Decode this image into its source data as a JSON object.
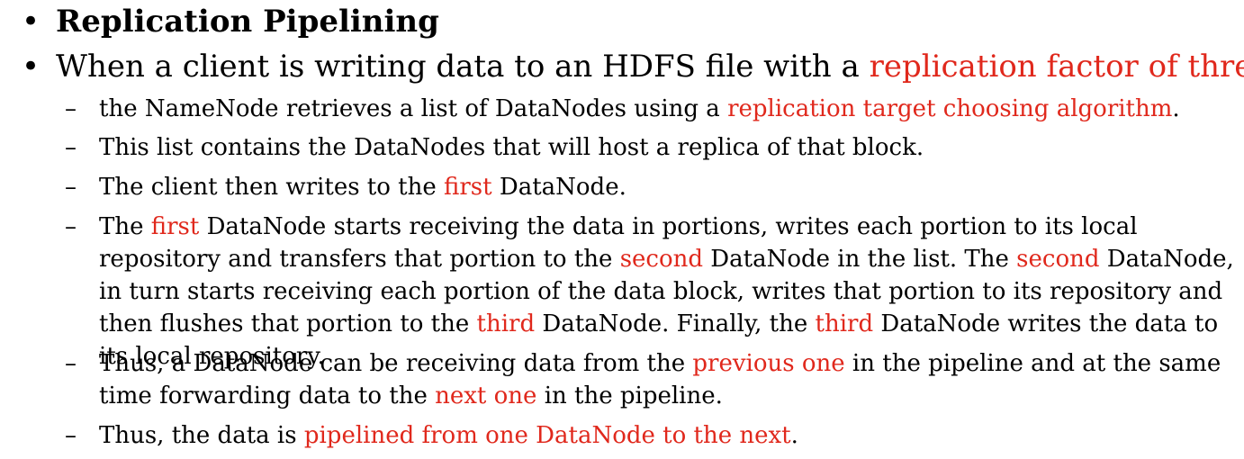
{
  "bullet_glyph": "•",
  "dash_glyph": "–",
  "highlight_color": "#e0281c",
  "title_bullet": "Replication Pipelining",
  "intro": {
    "before": "When a client is writing data to an HDFS file with a ",
    "hl": "replication factor of three",
    "after": ","
  },
  "items": [
    {
      "p1": "the NameNode retrieves a list of DataNodes using a ",
      "h1": "replication target choosing algorithm",
      "p2": "."
    },
    {
      "p1": "This list contains the DataNodes that will host a replica of that block."
    },
    {
      "p1": "The client then writes to the ",
      "h1": "first",
      "p2": " DataNode."
    },
    {
      "p1": "The ",
      "h1": "first",
      "p2": " DataNode starts receiving the data in portions, writes each portion to its local repository and transfers that portion to the ",
      "h2": "second",
      "p3": " DataNode in the list. The ",
      "h3": "second",
      "p4": " DataNode, in turn starts receiving each portion of the data block, writes that portion to its repository and then flushes that portion to the ",
      "h4": "third",
      "p5": " DataNode. Finally, the ",
      "h5": "third",
      "p6": " DataNode writes the data to its local repository."
    },
    {
      "p1": "Thus, a DataNode can be receiving data from the ",
      "h1": "previous one",
      "p2": " in the pipeline and at the same time forwarding data to the ",
      "h2": "next one",
      "p3": " in the pipeline."
    },
    {
      "p1": "Thus, the data is ",
      "h1": "pipelined from one DataNode to the next",
      "p2": "."
    }
  ]
}
